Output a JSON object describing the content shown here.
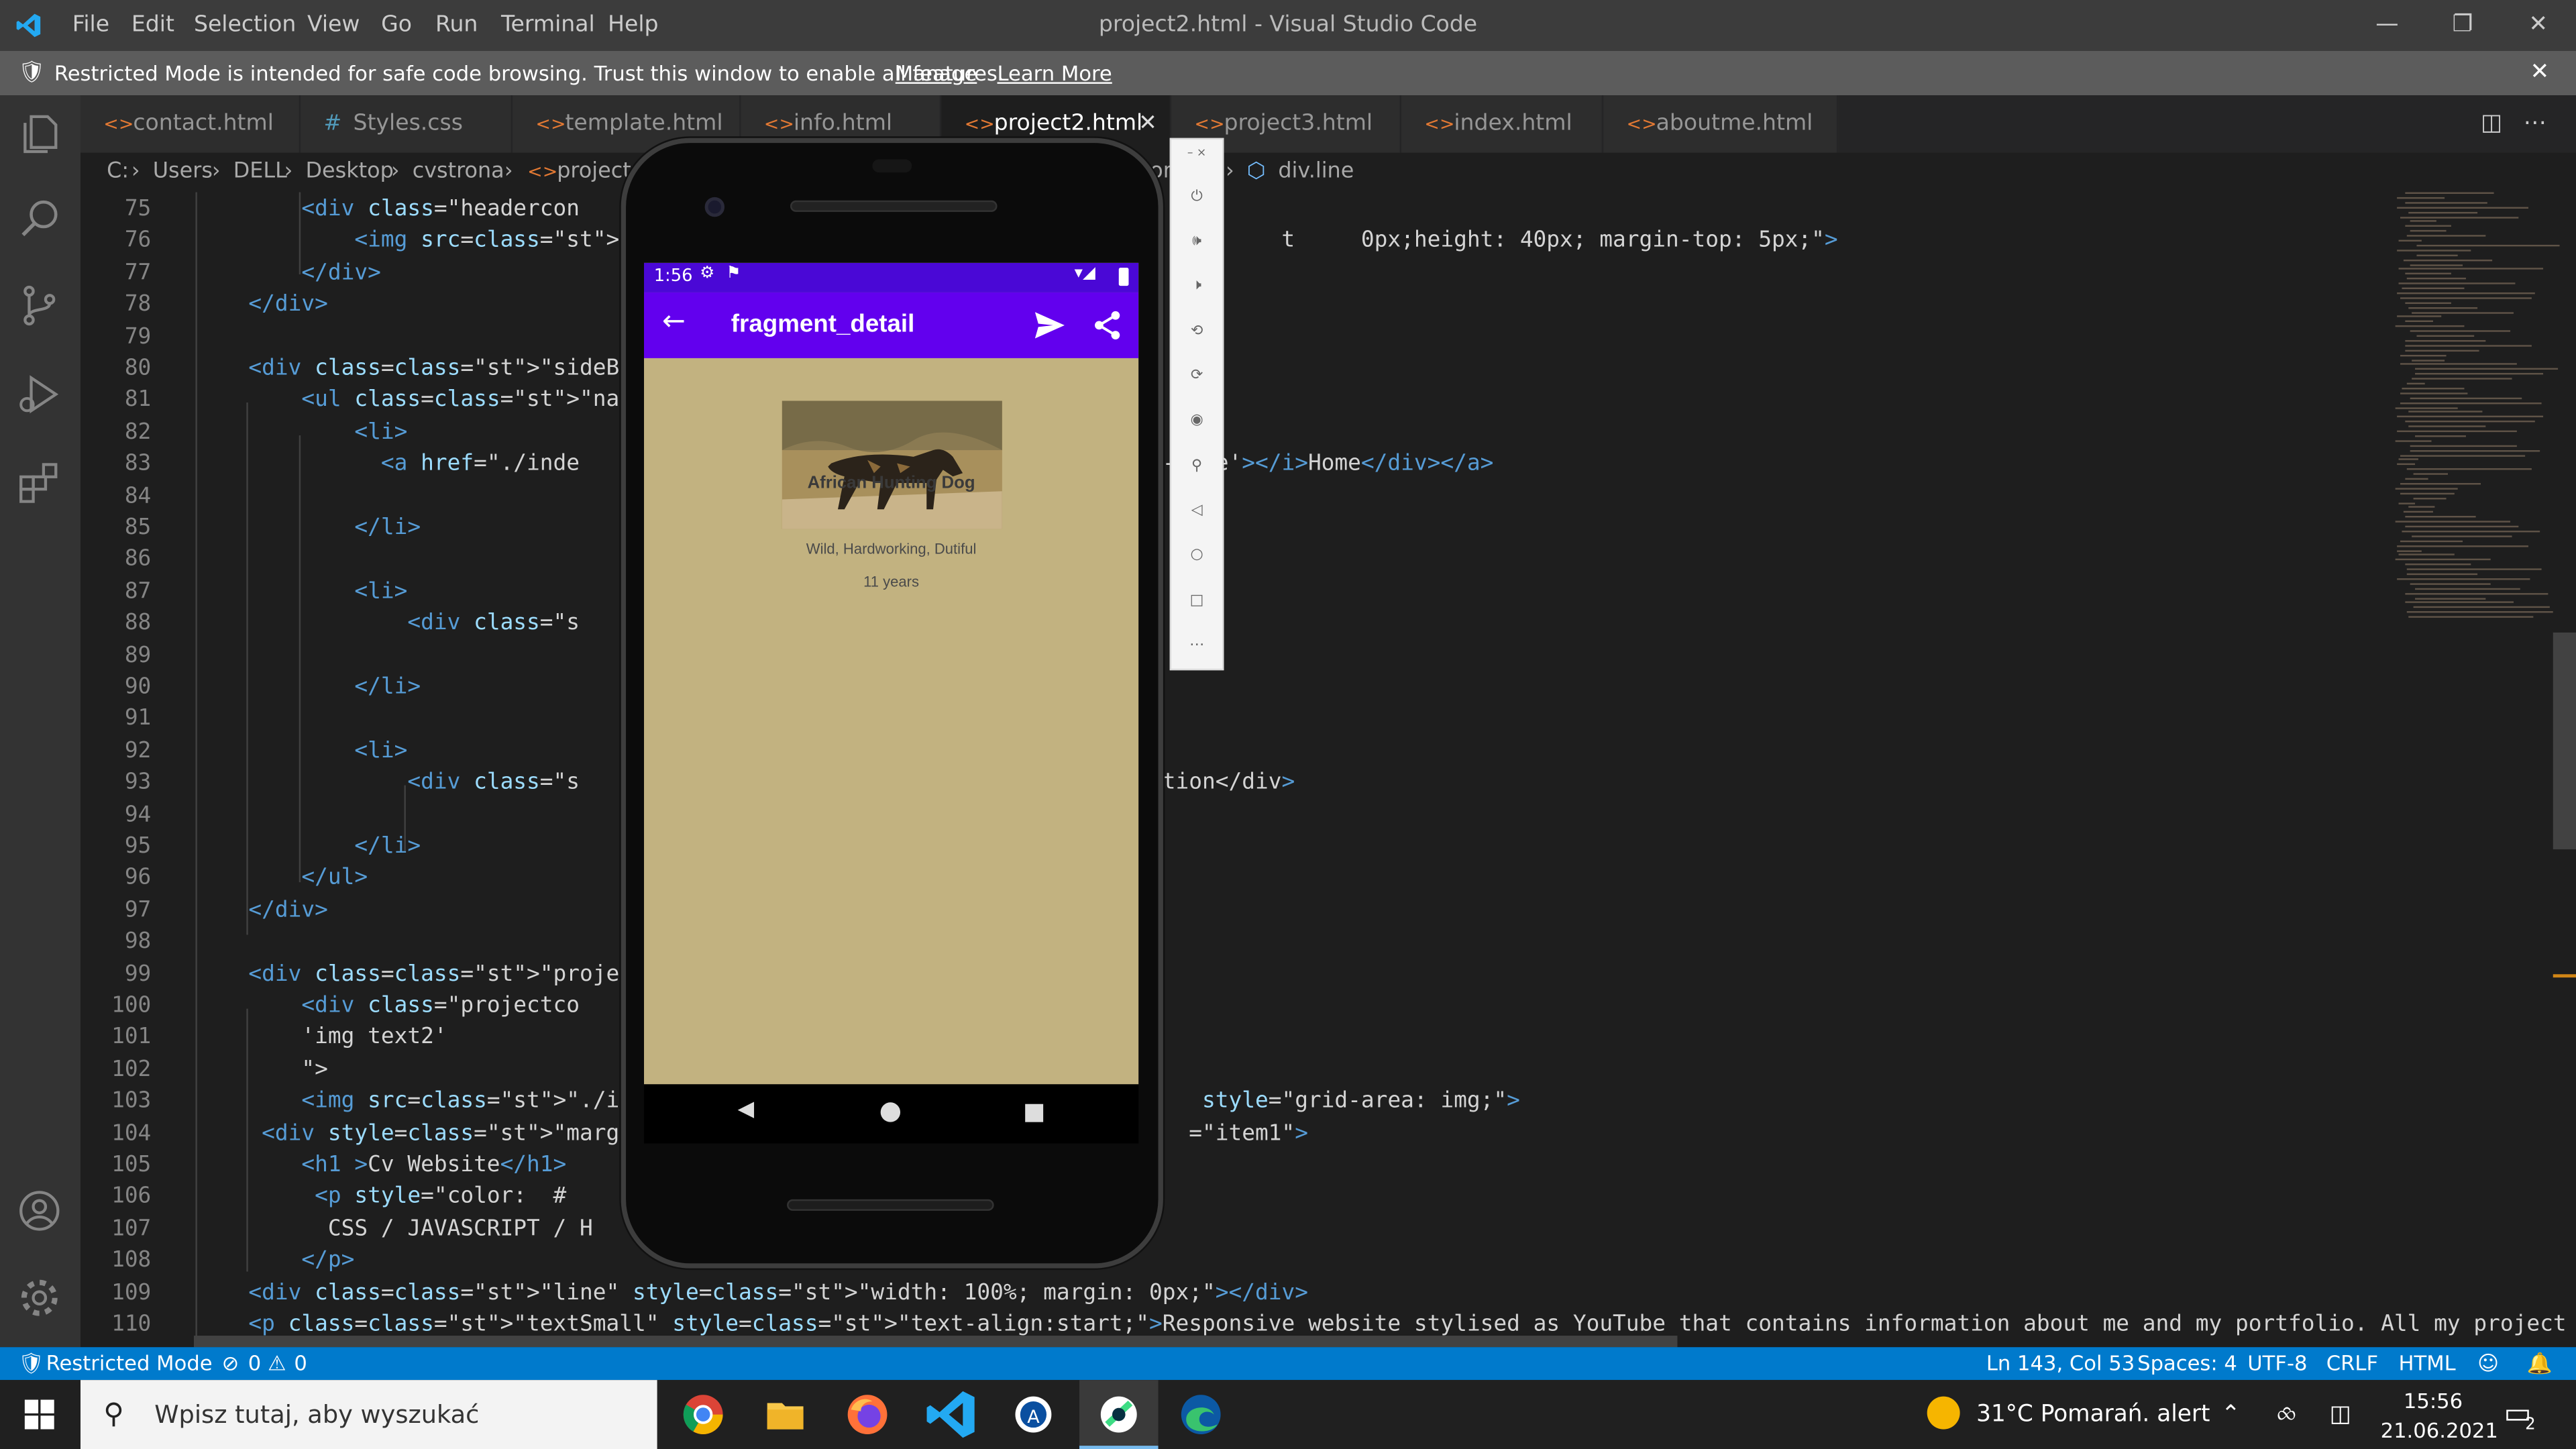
{
  "window": {
    "title": "project2.html - Visual Studio Code"
  },
  "menu": [
    "File",
    "Edit",
    "Selection",
    "View",
    "Go",
    "Run",
    "Terminal",
    "Help"
  ],
  "banner": {
    "text": "Restricted Mode is intended for safe code browsing. Trust this window to enable all features.",
    "manage": "Manage",
    "learn_more": "Learn More"
  },
  "tabs": [
    "contact.html",
    "Styles.css",
    "template.html",
    "info.html",
    "project2.html",
    "project3.html",
    "index.html",
    "aboutme.html"
  ],
  "active_tab": "project2.html",
  "breadcrumb": {
    "items": [
      "C:",
      "Users",
      "DELL",
      "Desktop",
      "cvstrona",
      "project"
    ],
    "fragment_tail": "or",
    "last": "div.line"
  },
  "code_lines": [
    {
      "n": "75",
      "t": "        <div class=\"headercon"
    },
    {
      "n": "76",
      "t": "            <img src=\"image/c                                          t     0px;height: 40px; margin-top: 5px;\">"
    },
    {
      "n": "77",
      "t": "        </div>"
    },
    {
      "n": "78",
      "t": "    </div>"
    },
    {
      "n": "79",
      "t": ""
    },
    {
      "n": "80",
      "t": "    <div class=\"sideBar\">"
    },
    {
      "n": "81",
      "t": "        <ul class=\"nav List\">"
    },
    {
      "n": "82",
      "t": "            <li>"
    },
    {
      "n": "83",
      "t": "              <a href=\"./inde                                         bxs-home'></i>Home</div></a>"
    },
    {
      "n": "84",
      "t": ""
    },
    {
      "n": "85",
      "t": "            </li>"
    },
    {
      "n": "86",
      "t": ""
    },
    {
      "n": "87",
      "t": "            <li>"
    },
    {
      "n": "88",
      "t": "                <div class=\"s                                      div>"
    },
    {
      "n": "89",
      "t": ""
    },
    {
      "n": "90",
      "t": "            </li>"
    },
    {
      "n": "91",
      "t": ""
    },
    {
      "n": "92",
      "t": "            <li>"
    },
    {
      "n": "93",
      "t": "                <div class=\"s                                    Subscription</div>"
    },
    {
      "n": "94",
      "t": ""
    },
    {
      "n": "95",
      "t": "            </li>"
    },
    {
      "n": "96",
      "t": "        </ul>"
    },
    {
      "n": "97",
      "t": "    </div>"
    },
    {
      "n": "98",
      "t": ""
    },
    {
      "n": "99",
      "t": "    <div class=\"project\">"
    },
    {
      "n": "100",
      "t": "        <div class=\"projectco                                    ext1'"
    },
    {
      "n": "101",
      "t": "        'img text2'"
    },
    {
      "n": "102",
      "t": "        \">"
    },
    {
      "n": "103",
      "t": "        <img src=\"./image/Pro                                    style=\"grid-area: img;\">"
    },
    {
      "n": "104",
      "t": "     <div style=\"margin: 20px                                   =\"item1\">"
    },
    {
      "n": "105",
      "t": "        <h1 >Cv Website</h1>"
    },
    {
      "n": "106",
      "t": "         <p style=\"color:  #"
    },
    {
      "n": "107",
      "t": "          CSS / JAVASCRIPT / H"
    },
    {
      "n": "108",
      "t": "        </p>"
    },
    {
      "n": "109",
      "t": "    <div class=\"line\" style=\"width: 100%; margin: 0px;\"></div>"
    },
    {
      "n": "110",
      "t": "    <p class=\"textSmall\" style=\"text-align:start;\">Responsive website stylised as YouTube that contains information about me and my portfolio. All my project can be a"
    }
  ],
  "phone": {
    "status_time": "1:56",
    "appbar_title": "fragment_detail",
    "animal_name": "African Hunting Dog",
    "traits": "Wild, Hardworking, Dutiful",
    "age": "11 years"
  },
  "status": {
    "restricted": "Restricted Mode",
    "errors": "0",
    "warnings": "0",
    "position": "Ln 143, Col 53",
    "spaces": "Spaces: 4",
    "encoding": "UTF-8",
    "eol": "CRLF",
    "language": "HTML"
  },
  "taskbar": {
    "search_placeholder": "Wpisz tutaj, aby wyszukać",
    "weather": "31°C  Pomarań. alert",
    "time": "15:56",
    "date": "21.06.2021",
    "notifications": "2"
  },
  "colors": {
    "accent": "#007acc",
    "phone_appbar": "#6200ee",
    "phone_statusbar": "#4a08d6",
    "phone_bg": "#c2b280"
  }
}
